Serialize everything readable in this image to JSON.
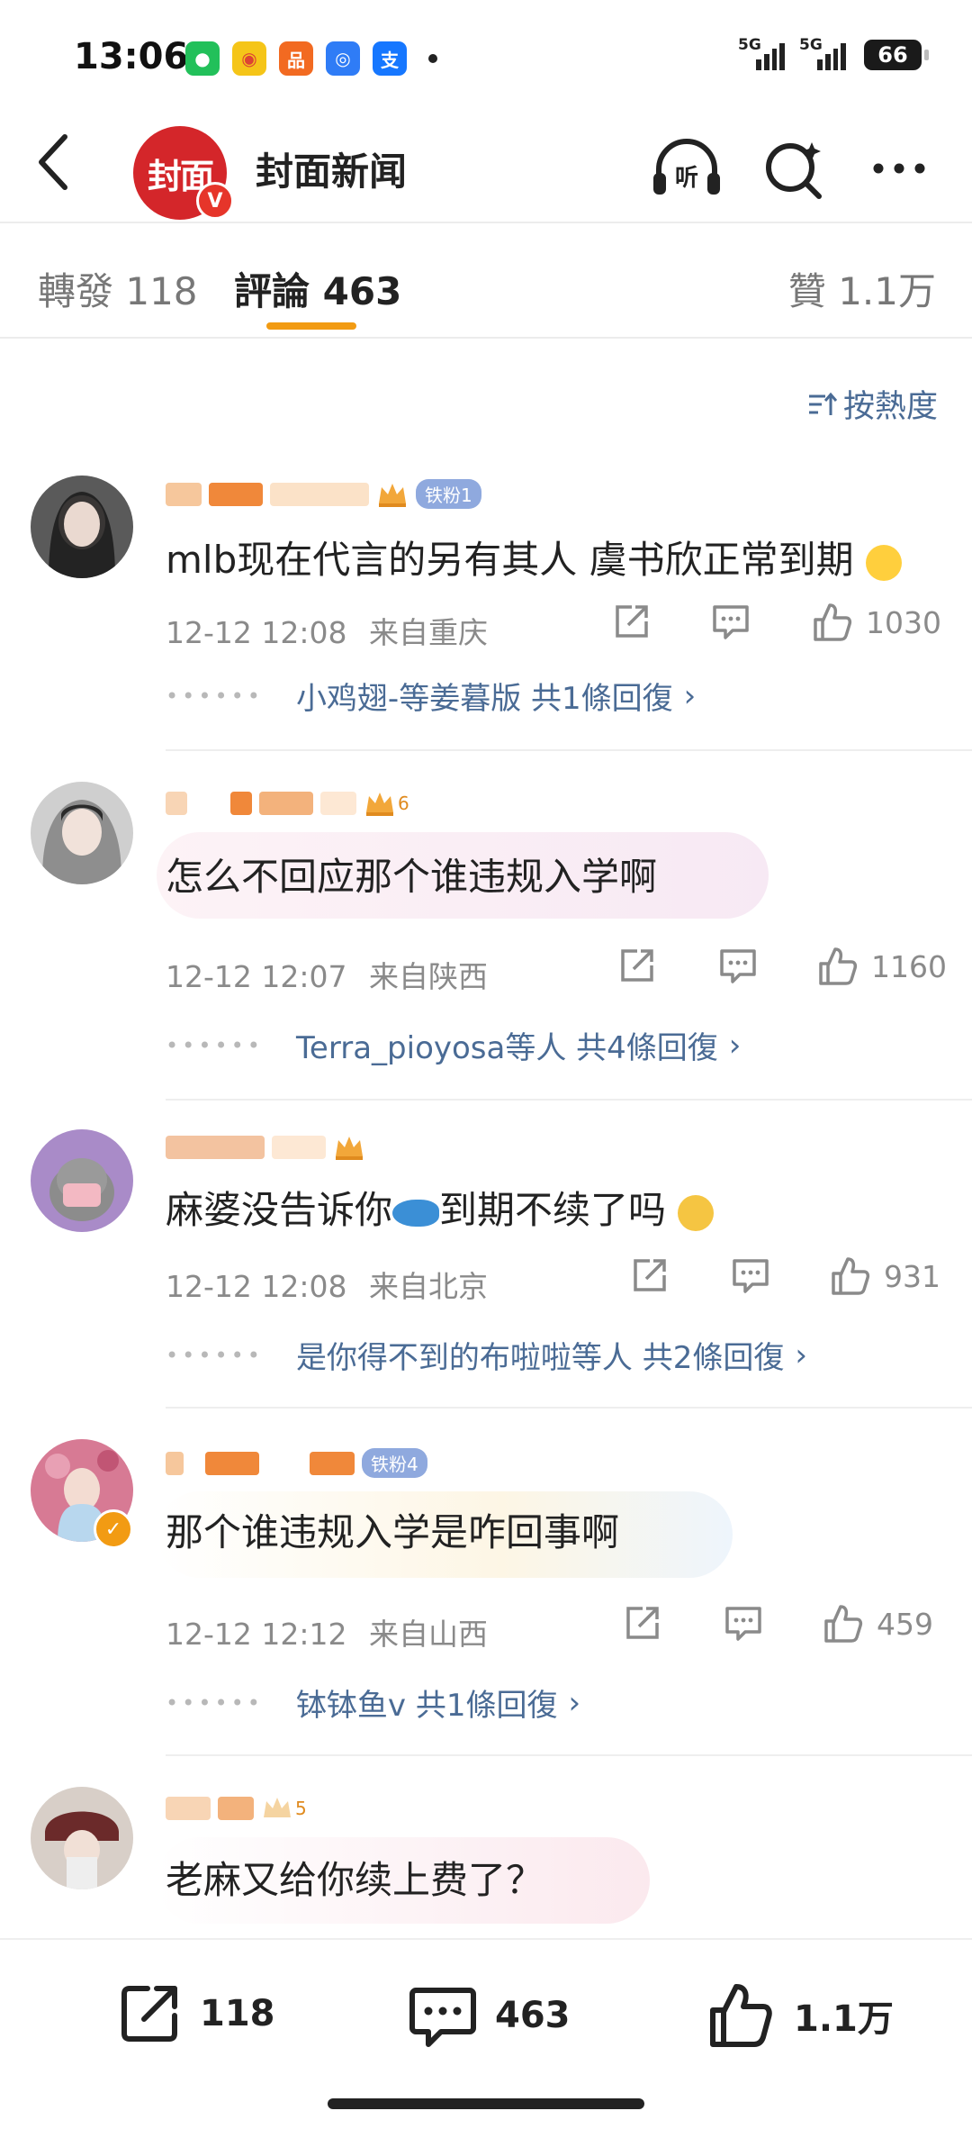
{
  "status_bar": {
    "time": "13:06",
    "apps": [
      {
        "icon": "wechat-icon",
        "color": "#22c05a",
        "glyph": "●"
      },
      {
        "icon": "weibo-icon",
        "color": "#f5a623",
        "glyph": "◉"
      },
      {
        "icon": "taobao-icon",
        "color": "#f26a21",
        "glyph": "品"
      },
      {
        "icon": "browser-icon",
        "color": "#2f7cf6",
        "glyph": "◎"
      },
      {
        "icon": "alipay-icon",
        "color": "#1677ff",
        "glyph": "支"
      }
    ],
    "signal_1": "5G",
    "signal_2": "5G",
    "battery": "66"
  },
  "header": {
    "logo_text": "封面",
    "verified_badge": "V",
    "account_name": "封面新闻"
  },
  "tabs": {
    "repost": "轉發 118",
    "comments": "評論 463",
    "likes": "贊 1.1万"
  },
  "sort_label": "按熱度",
  "comments": [
    {
      "badge": "铁粉1",
      "text": "mlb现在代言的另有其人 虞书欣正常到期",
      "date": "12-12 12:08",
      "location": "来自重庆",
      "likes": "1030",
      "reply_summary": "小鸡翅-等姜暮版 共1條回復",
      "avatar_color": "#3a3a3a"
    },
    {
      "badge": "6",
      "text": "怎么不回应那个谁违规入学啊",
      "date": "12-12 12:07",
      "location": "来自陕西",
      "likes": "1160",
      "reply_summary": "Terra_pioyosa等人 共4條回復",
      "avatar_color": "#bdbdbd"
    },
    {
      "badge": "",
      "text": "麻婆没告诉你",
      "text_suffix": "到期不续了吗",
      "date": "12-12 12:08",
      "location": "来自北京",
      "likes": "931",
      "reply_summary": "是你得不到的布啦啦等人 共2條回復",
      "avatar_color": "#9b7fb8"
    },
    {
      "badge": "铁粉4",
      "text": "那个谁违规入学是咋回事啊",
      "date": "12-12 12:12",
      "location": "来自山西",
      "likes": "459",
      "reply_summary": "钵钵鱼v 共1條回復",
      "avatar_color": "#c77b8a"
    },
    {
      "badge": "5",
      "text": "老麻又给你续上费了？",
      "avatar_color": "#7a3b3b"
    }
  ],
  "bottom_bar": {
    "reposts": "118",
    "comments": "463",
    "likes": "1.1万"
  }
}
